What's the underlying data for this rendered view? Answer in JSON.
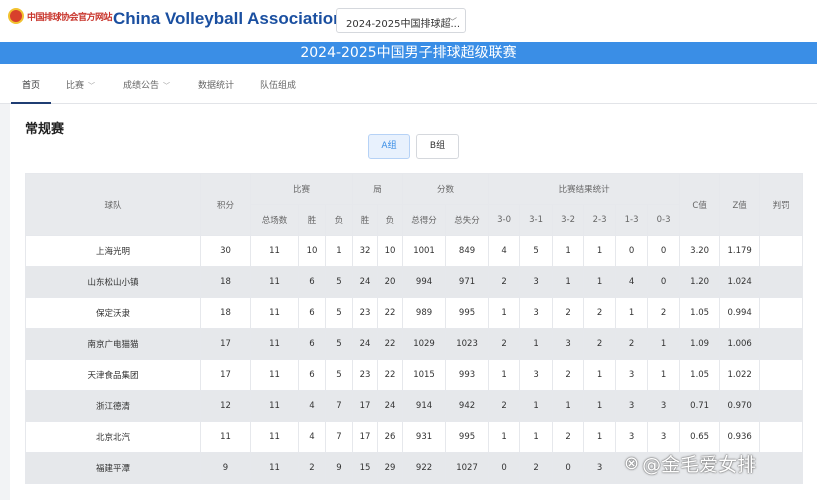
{
  "header": {
    "logo_text": "中国排球协会官方网站",
    "assoc_name": "China Volleyball Association",
    "season_select": "2024-2025中国排球超...",
    "season_chevron": "﹀"
  },
  "banner": {
    "title": "2024-2025中国男子排球超级联赛"
  },
  "nav": {
    "items": [
      {
        "label": "首页"
      },
      {
        "label": "比赛"
      },
      {
        "label": "成绩公告"
      },
      {
        "label": "数据统计"
      },
      {
        "label": "队伍组成"
      }
    ],
    "caret": "﹀"
  },
  "section": {
    "title": "常规赛"
  },
  "groups": {
    "a": "A组",
    "b": "B组"
  },
  "table": {
    "headers": {
      "team": "球队",
      "points": "积分",
      "matches": "比赛",
      "sets": "局",
      "scores": "分数",
      "result_stats": "比赛结果统计",
      "c_value": "C值",
      "z_value": "Z值",
      "penalty": "判罚",
      "total_matches": "总场数",
      "win": "胜",
      "loss": "负",
      "sets_win": "胜",
      "sets_loss": "负",
      "total_for": "总得分",
      "total_against": "总失分",
      "r30": "3-0",
      "r31": "3-1",
      "r32": "3-2",
      "r23": "2-3",
      "r13": "1-3",
      "r03": "0-3"
    },
    "rows": [
      [
        "上海光明",
        "30",
        "11",
        "10",
        "1",
        "32",
        "10",
        "1001",
        "849",
        "4",
        "5",
        "1",
        "1",
        "0",
        "0",
        "3.20",
        "1.179",
        ""
      ],
      [
        "山东松山小镇",
        "18",
        "11",
        "6",
        "5",
        "24",
        "20",
        "994",
        "971",
        "2",
        "3",
        "1",
        "1",
        "4",
        "0",
        "1.20",
        "1.024",
        ""
      ],
      [
        "保定沃隶",
        "18",
        "11",
        "6",
        "5",
        "23",
        "22",
        "989",
        "995",
        "1",
        "3",
        "2",
        "2",
        "1",
        "2",
        "1.05",
        "0.994",
        ""
      ],
      [
        "南京广电猫猫",
        "17",
        "11",
        "6",
        "5",
        "24",
        "22",
        "1029",
        "1023",
        "2",
        "1",
        "3",
        "2",
        "2",
        "1",
        "1.09",
        "1.006",
        ""
      ],
      [
        "天津食品集团",
        "17",
        "11",
        "6",
        "5",
        "23",
        "22",
        "1015",
        "993",
        "1",
        "3",
        "2",
        "1",
        "3",
        "1",
        "1.05",
        "1.022",
        ""
      ],
      [
        "浙江德清",
        "12",
        "11",
        "4",
        "7",
        "17",
        "24",
        "914",
        "942",
        "2",
        "1",
        "1",
        "1",
        "3",
        "3",
        "0.71",
        "0.970",
        ""
      ],
      [
        "北京北汽",
        "11",
        "11",
        "4",
        "7",
        "17",
        "26",
        "931",
        "995",
        "1",
        "1",
        "2",
        "1",
        "3",
        "3",
        "0.65",
        "0.936",
        ""
      ],
      [
        "福建平潭",
        "9",
        "11",
        "2",
        "9",
        "15",
        "29",
        "922",
        "1027",
        "0",
        "2",
        "0",
        "3",
        "",
        "",
        "",
        "",
        ""
      ]
    ]
  },
  "watermark": {
    "icon": "⊗",
    "text": "@金毛爱女排"
  }
}
